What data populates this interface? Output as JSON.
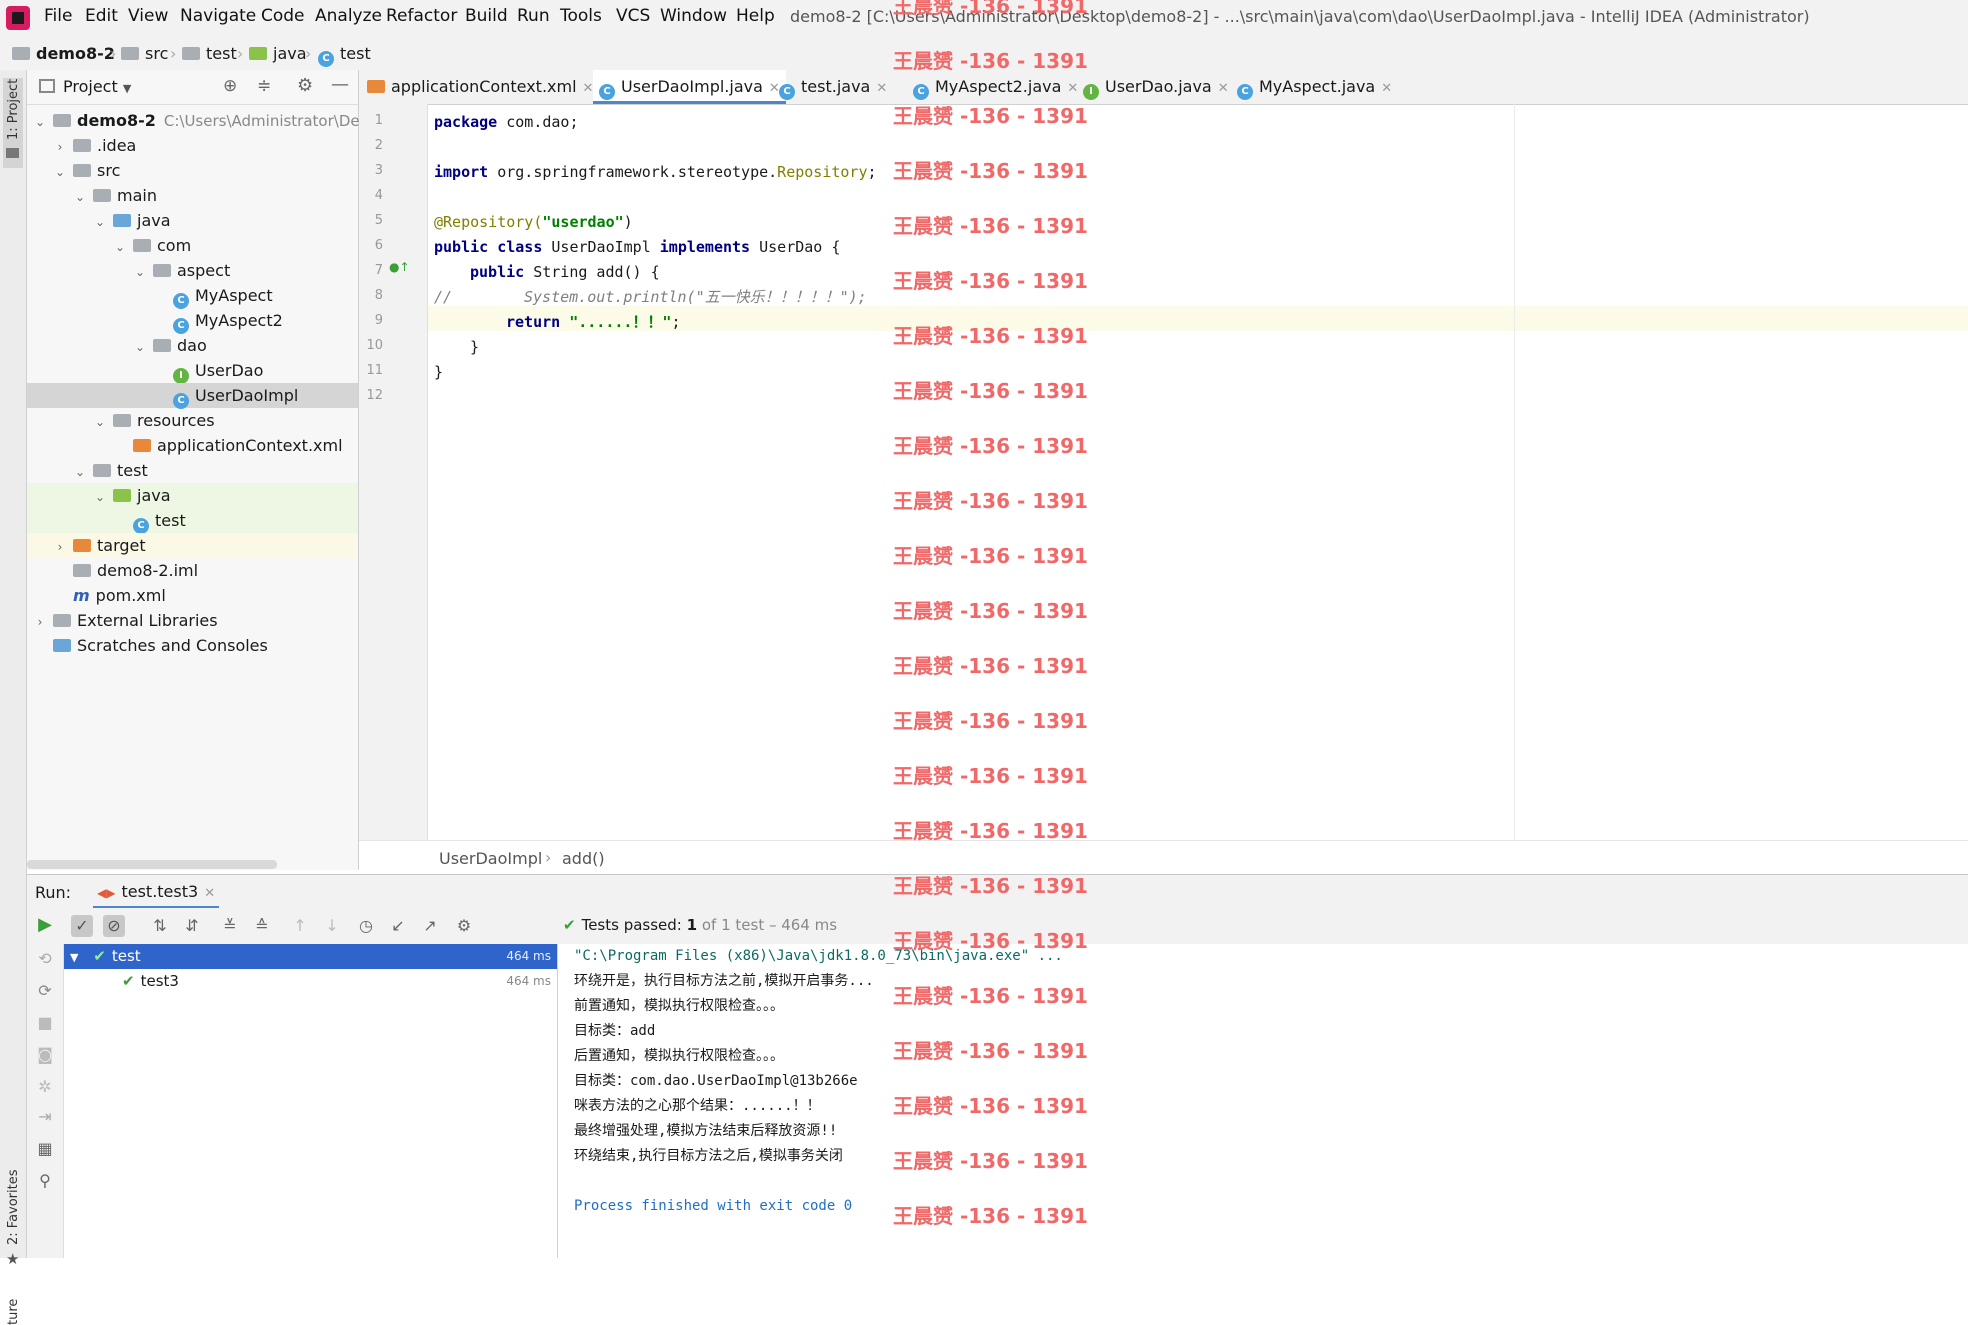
{
  "menu": {
    "items": [
      "File",
      "Edit",
      "View",
      "Navigate",
      "Code",
      "Analyze",
      "Refactor",
      "Build",
      "Run",
      "Tools",
      "VCS",
      "Window",
      "Help"
    ],
    "title": "demo8-2 [C:\\Users\\Administrator\\Desktop\\demo8-2] - ...\\src\\main\\java\\com\\dao\\UserDaoImpl.java - IntelliJ IDEA (Administrator)"
  },
  "breadcrumb": [
    "demo8-2",
    "src",
    "test",
    "java",
    "test"
  ],
  "left_stripe": {
    "project": "1: Project",
    "favorites": "2: Favorites",
    "structure": "ture"
  },
  "project": {
    "header": "Project",
    "tree": [
      {
        "label": "demo8-2",
        "extra": "C:\\Users\\Administrator\\Des",
        "depth": 0,
        "icon": "module-folder-icon",
        "arrow": "down",
        "bold": true
      },
      {
        "label": ".idea",
        "depth": 1,
        "icon": "folder-icon",
        "arrow": "right"
      },
      {
        "label": "src",
        "depth": 1,
        "icon": "folder-icon",
        "arrow": "down"
      },
      {
        "label": "main",
        "depth": 2,
        "icon": "folder-icon",
        "arrow": "down"
      },
      {
        "label": "java",
        "depth": 3,
        "icon": "source-folder-icon",
        "arrow": "down"
      },
      {
        "label": "com",
        "depth": 4,
        "icon": "package-icon",
        "arrow": "down"
      },
      {
        "label": "aspect",
        "depth": 5,
        "icon": "package-icon",
        "arrow": "down"
      },
      {
        "label": "MyAspect",
        "depth": 6,
        "icon": "class-icon",
        "arrow": ""
      },
      {
        "label": "MyAspect2",
        "depth": 6,
        "icon": "class-icon",
        "arrow": ""
      },
      {
        "label": "dao",
        "depth": 5,
        "icon": "package-icon",
        "arrow": "down"
      },
      {
        "label": "UserDao",
        "depth": 6,
        "icon": "interface-icon",
        "arrow": ""
      },
      {
        "label": "UserDaoImpl",
        "depth": 6,
        "icon": "class-icon",
        "arrow": "",
        "selected": true
      },
      {
        "label": "resources",
        "depth": 3,
        "icon": "resources-folder-icon",
        "arrow": "down"
      },
      {
        "label": "applicationContext.xml",
        "depth": 4,
        "icon": "xml-file-icon",
        "arrow": ""
      },
      {
        "label": "test",
        "depth": 2,
        "icon": "folder-icon",
        "arrow": "down"
      },
      {
        "label": "java",
        "depth": 3,
        "icon": "test-source-folder-icon",
        "arrow": "down",
        "highlight": true
      },
      {
        "label": "test",
        "depth": 4,
        "icon": "test-class-icon",
        "arrow": "",
        "highlight": true
      },
      {
        "label": "target",
        "depth": 1,
        "icon": "excluded-folder-icon",
        "arrow": "right",
        "highlight_yellow": true
      },
      {
        "label": "demo8-2.iml",
        "depth": 1,
        "icon": "iml-file-icon",
        "arrow": ""
      },
      {
        "label": "pom.xml",
        "depth": 1,
        "icon": "maven-icon",
        "arrow": ""
      },
      {
        "label": "External Libraries",
        "depth": 0,
        "icon": "libraries-icon",
        "arrow": "right"
      },
      {
        "label": "Scratches and Consoles",
        "depth": 0,
        "icon": "scratches-icon",
        "arrow": ""
      }
    ]
  },
  "editor": {
    "tabs": [
      {
        "label": "applicationContext.xml",
        "icon": "xml-file-icon",
        "active": false
      },
      {
        "label": "UserDaoImpl.java",
        "icon": "class-icon",
        "active": true
      },
      {
        "label": "test.java",
        "icon": "test-class-icon",
        "active": false
      },
      {
        "label": "MyAspect2.java",
        "icon": "class-icon",
        "active": false
      },
      {
        "label": "UserDao.java",
        "icon": "interface-icon",
        "active": false
      },
      {
        "label": "MyAspect.java",
        "icon": "class-icon",
        "active": false
      }
    ],
    "line_numbers": [
      "1",
      "2",
      "3",
      "4",
      "5",
      "6",
      "7",
      "8",
      "9",
      "10",
      "11",
      "12"
    ],
    "code": {
      "l1_kw": "package",
      "l1_rest": " com.dao;",
      "l3_kw": "import",
      "l3_rest": " org.springframework.stereotype.",
      "l3_ref": "Repository",
      "l3_end": ";",
      "l5_ann": "@Repository(",
      "l5_str": "\"userdao\"",
      "l5_end": ")",
      "l6_kw1": "public",
      "l6_kw2": "class",
      "l6_mid": " UserDaoImpl ",
      "l6_kw3": "implements",
      "l6_end": " UserDao {",
      "l7_kw": "public",
      "l7_rest": " String add() {",
      "l8_cmt1": "//",
      "l8_cmt2": "System.out.println(\"五一快乐！！！！！\");",
      "l9_kw": "return",
      "l9_str": "\"......！！\"",
      "l9_end": ";",
      "l10": "}",
      "l11": "}"
    },
    "crumb": [
      "UserDaoImpl",
      "add()"
    ]
  },
  "run": {
    "label": "Run:",
    "tab": "test.test3",
    "status_prefix": "Tests passed:",
    "status_count": "1",
    "status_rest": "of 1 test – 464 ms",
    "tree": [
      {
        "label": "test",
        "ms": "464 ms",
        "selected": true
      },
      {
        "label": "test3",
        "ms": "464 ms",
        "selected": false
      }
    ],
    "console": {
      "cmd": "\"C:\\Program Files (x86)\\Java\\jdk1.8.0_73\\bin\\java.exe\" ...",
      "lines": [
        "环绕开是，执行目标方法之前,模拟开启事务...",
        "前置通知，模拟执行权限检查。。。",
        "目标类：add",
        "后置通知，模拟执行权限检查。。。",
        "目标类：com.dao.UserDaoImpl@13b266e",
        "咪表方法的之心那个结果：......！！",
        "最终增强处理,模拟方法结束后释放资源!!",
        "环绕结束,执行目标方法之后,模拟事务关闭"
      ],
      "exit": "Process finished with exit code 0"
    }
  },
  "watermark": "王晨赟 -136 - 1391",
  "colors": {
    "accent": "#4a88c7",
    "selection": "#2f65ca",
    "watermark": "#f06868",
    "pass": "#3a9e3a"
  }
}
